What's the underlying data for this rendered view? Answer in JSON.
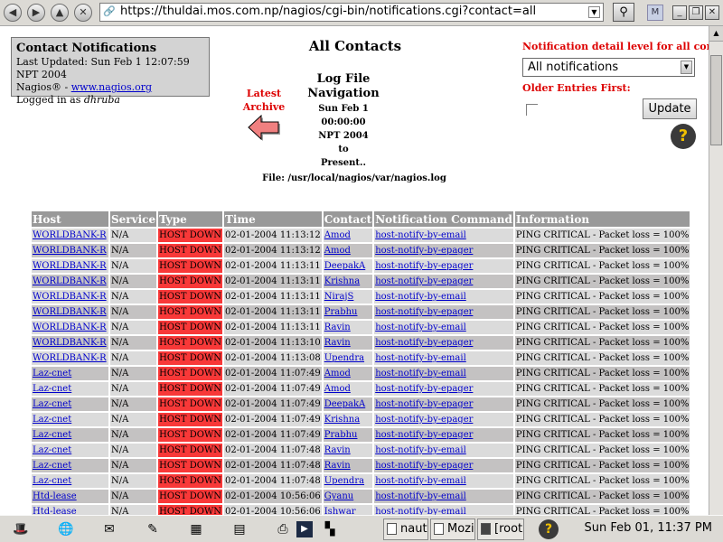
{
  "browser": {
    "url": "https://thuldai.mos.com.np/nagios/cgi-bin/notifications.cgi?contact=all",
    "back_icon": "back-arrow-icon",
    "forward_icon": "forward-arrow-icon",
    "up_icon": "up-arrow-icon",
    "stop_icon": "stop-icon",
    "search_icon": "magnifier-icon"
  },
  "info_box": {
    "title": "Contact Notifications",
    "last_updated": "Last Updated: Sun Feb 1 12:07:59 NPT 2004",
    "nagios_prefix": "Nagios® - ",
    "nagios_link": "www.nagios.org",
    "logged_in_prefix": "Logged in as ",
    "user": "dhruba"
  },
  "page_title": "All Contacts",
  "archive": {
    "label_line1": "Latest",
    "label_line2": "Archive",
    "arrow_color": "#f08080"
  },
  "log_nav": {
    "title_line1": "Log File",
    "title_line2": "Navigation",
    "start_line1": "Sun Feb 1 00:00:00",
    "start_line2": "NPT 2004",
    "to": "to",
    "end": "Present.."
  },
  "options": {
    "detail_label": "Notification detail level for all contacts:",
    "detail_value": "All notifications",
    "older_label": "Older Entries First:",
    "update_button": "Update",
    "label_color": "#dd0000"
  },
  "file_label": "File: /usr/local/nagios/var/nagios.log",
  "table": {
    "headers": [
      "Host",
      "Service",
      "Type",
      "Time",
      "Contact",
      "Notification Command",
      "Information"
    ],
    "type_color": "#f83838",
    "rows": [
      {
        "host": "WORLDBANK-R",
        "service": "N/A",
        "type": "HOST DOWN",
        "time": "02-01-2004 11:13:12",
        "contact": "Amod",
        "command": "host-notify-by-email",
        "info": "PING CRITICAL - Packet loss = 100%"
      },
      {
        "host": "WORLDBANK-R",
        "service": "N/A",
        "type": "HOST DOWN",
        "time": "02-01-2004 11:13:12",
        "contact": "Amod",
        "command": "host-notify-by-epager",
        "info": "PING CRITICAL - Packet loss = 100%"
      },
      {
        "host": "WORLDBANK-R",
        "service": "N/A",
        "type": "HOST DOWN",
        "time": "02-01-2004 11:13:11",
        "contact": "DeepakA",
        "command": "host-notify-by-epager",
        "info": "PING CRITICAL - Packet loss = 100%"
      },
      {
        "host": "WORLDBANK-R",
        "service": "N/A",
        "type": "HOST DOWN",
        "time": "02-01-2004 11:13:11",
        "contact": "Krishna",
        "command": "host-notify-by-epager",
        "info": "PING CRITICAL - Packet loss = 100%"
      },
      {
        "host": "WORLDBANK-R",
        "service": "N/A",
        "type": "HOST DOWN",
        "time": "02-01-2004 11:13:11",
        "contact": "NirajS",
        "command": "host-notify-by-email",
        "info": "PING CRITICAL - Packet loss = 100%"
      },
      {
        "host": "WORLDBANK-R",
        "service": "N/A",
        "type": "HOST DOWN",
        "time": "02-01-2004 11:13:11",
        "contact": "Prabhu",
        "command": "host-notify-by-epager",
        "info": "PING CRITICAL - Packet loss = 100%"
      },
      {
        "host": "WORLDBANK-R",
        "service": "N/A",
        "type": "HOST DOWN",
        "time": "02-01-2004 11:13:11",
        "contact": "Ravin",
        "command": "host-notify-by-email",
        "info": "PING CRITICAL - Packet loss = 100%"
      },
      {
        "host": "WORLDBANK-R",
        "service": "N/A",
        "type": "HOST DOWN",
        "time": "02-01-2004 11:13:10",
        "contact": "Ravin",
        "command": "host-notify-by-epager",
        "info": "PING CRITICAL - Packet loss = 100%"
      },
      {
        "host": "WORLDBANK-R",
        "service": "N/A",
        "type": "HOST DOWN",
        "time": "02-01-2004 11:13:08",
        "contact": "Upendra",
        "command": "host-notify-by-email",
        "info": "PING CRITICAL - Packet loss = 100%"
      },
      {
        "host": "Laz-cnet",
        "service": "N/A",
        "type": "HOST DOWN",
        "time": "02-01-2004 11:07:49",
        "contact": "Amod",
        "command": "host-notify-by-email",
        "info": "PING CRITICAL - Packet loss = 100%"
      },
      {
        "host": "Laz-cnet",
        "service": "N/A",
        "type": "HOST DOWN",
        "time": "02-01-2004 11:07:49",
        "contact": "Amod",
        "command": "host-notify-by-epager",
        "info": "PING CRITICAL - Packet loss = 100%"
      },
      {
        "host": "Laz-cnet",
        "service": "N/A",
        "type": "HOST DOWN",
        "time": "02-01-2004 11:07:49",
        "contact": "DeepakA",
        "command": "host-notify-by-epager",
        "info": "PING CRITICAL - Packet loss = 100%"
      },
      {
        "host": "Laz-cnet",
        "service": "N/A",
        "type": "HOST DOWN",
        "time": "02-01-2004 11:07:49",
        "contact": "Krishna",
        "command": "host-notify-by-epager",
        "info": "PING CRITICAL - Packet loss = 100%"
      },
      {
        "host": "Laz-cnet",
        "service": "N/A",
        "type": "HOST DOWN",
        "time": "02-01-2004 11:07:49",
        "contact": "Prabhu",
        "command": "host-notify-by-epager",
        "info": "PING CRITICAL - Packet loss = 100%"
      },
      {
        "host": "Laz-cnet",
        "service": "N/A",
        "type": "HOST DOWN",
        "time": "02-01-2004 11:07:48",
        "contact": "Ravin",
        "command": "host-notify-by-email",
        "info": "PING CRITICAL - Packet loss = 100%"
      },
      {
        "host": "Laz-cnet",
        "service": "N/A",
        "type": "HOST DOWN",
        "time": "02-01-2004 11:07:48",
        "contact": "Ravin",
        "command": "host-notify-by-epager",
        "info": "PING CRITICAL - Packet loss = 100%"
      },
      {
        "host": "Laz-cnet",
        "service": "N/A",
        "type": "HOST DOWN",
        "time": "02-01-2004 11:07:48",
        "contact": "Upendra",
        "command": "host-notify-by-email",
        "info": "PING CRITICAL - Packet loss = 100%"
      },
      {
        "host": "Htd-lease",
        "service": "N/A",
        "type": "HOST DOWN",
        "time": "02-01-2004 10:56:06",
        "contact": "Gyanu",
        "command": "host-notify-by-email",
        "info": "PING CRITICAL - Packet loss = 100%"
      },
      {
        "host": "Htd-lease",
        "service": "N/A",
        "type": "HOST DOWN",
        "time": "02-01-2004 10:56:06",
        "contact": "Ishwar",
        "command": "host-notify-by-email",
        "info": "PING CRITICAL - Packet loss = 100%"
      }
    ]
  },
  "taskbar": {
    "launchers": [
      "redhat-menu-icon",
      "web-browser-icon",
      "email-icon",
      "writer-icon",
      "presentation-icon",
      "spreadsheet-icon",
      "printer-icon",
      "terminal-icon",
      "workspace-switcher-icon"
    ],
    "tasks": [
      "nautil",
      "Mozil",
      "[root@"
    ],
    "help_icon": "help-icon",
    "clock": "Sun Feb 01, 11:37 PM"
  }
}
